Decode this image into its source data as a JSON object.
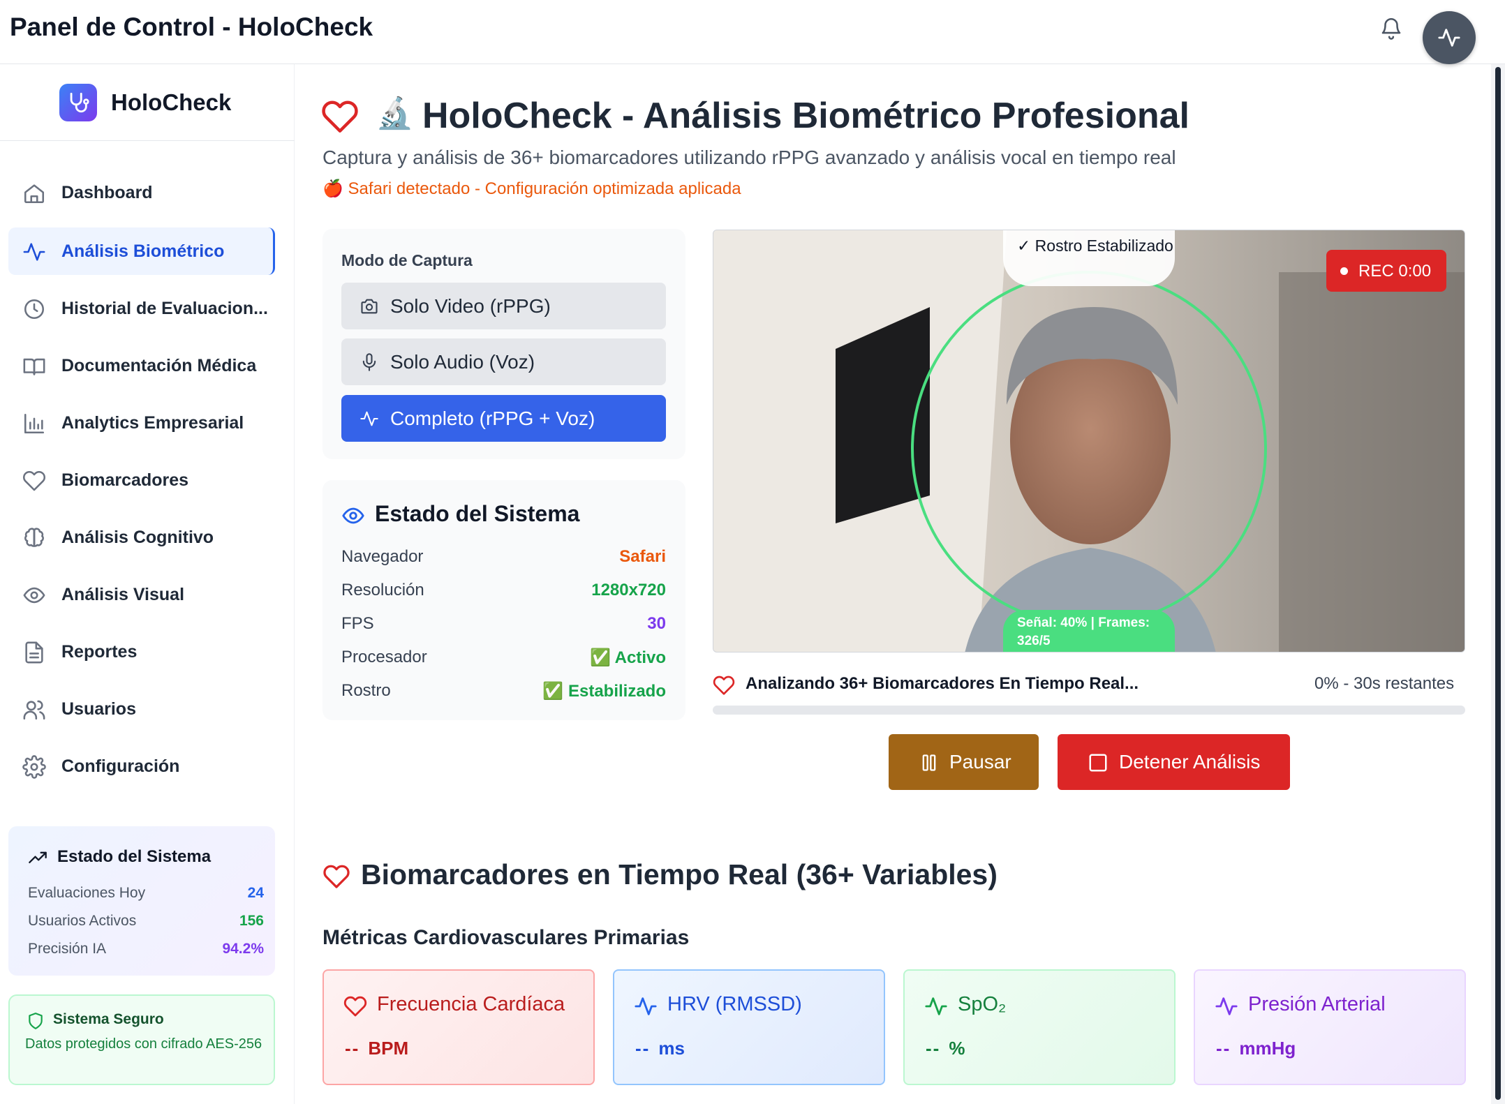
{
  "header": {
    "title": "Panel de Control - HoloCheck",
    "bell_icon": "bell-icon",
    "avatar_icon": "activity-icon"
  },
  "sidebar": {
    "brand": "HoloCheck",
    "items": [
      {
        "label": "Dashboard",
        "icon": "home-icon",
        "active": false
      },
      {
        "label": "Análisis Biométrico",
        "icon": "activity-icon",
        "active": true
      },
      {
        "label": "Historial de Evaluacion...",
        "icon": "clock-icon",
        "active": false
      },
      {
        "label": "Documentación Médica",
        "icon": "book-icon",
        "active": false
      },
      {
        "label": "Analytics Empresarial",
        "icon": "bar-chart-icon",
        "active": false
      },
      {
        "label": "Biomarcadores",
        "icon": "heart-icon",
        "active": false
      },
      {
        "label": "Análisis Cognitivo",
        "icon": "brain-icon",
        "active": false
      },
      {
        "label": "Análisis Visual",
        "icon": "eye-icon",
        "active": false
      },
      {
        "label": "Reportes",
        "icon": "file-icon",
        "active": false
      },
      {
        "label": "Usuarios",
        "icon": "users-icon",
        "active": false
      },
      {
        "label": "Configuración",
        "icon": "gear-icon",
        "active": false
      }
    ],
    "system_status": {
      "title": "Estado del Sistema",
      "rows": [
        {
          "label": "Evaluaciones Hoy",
          "value": "24",
          "color": "#2563eb"
        },
        {
          "label": "Usuarios Activos",
          "value": "156",
          "color": "#16a34a"
        },
        {
          "label": "Precisión IA",
          "value": "94.2%",
          "color": "#7c3aed"
        }
      ]
    },
    "security": {
      "title": "Sistema Seguro",
      "text": "Datos protegidos con cifrado AES-256"
    }
  },
  "main": {
    "title": "HoloCheck - Análisis Biométrico Profesional",
    "title_emoji": "🔬",
    "subtitle": "Captura y análisis de 36+ biomarcadores utilizando rPPG avanzado y análisis vocal en tiempo real",
    "safari_note": "🍎 Safari detectado - Configuración optimizada aplicada",
    "capture": {
      "label": "Modo de Captura",
      "modes": [
        {
          "label": "Solo Video (rPPG)",
          "icon": "camera-icon",
          "selected": false
        },
        {
          "label": "Solo Audio (Voz)",
          "icon": "mic-icon",
          "selected": false
        },
        {
          "label": "Completo (rPPG + Voz)",
          "icon": "activity-icon",
          "selected": true
        }
      ]
    },
    "status": {
      "title": "Estado del Sistema",
      "rows": [
        {
          "label": "Navegador",
          "value": "Safari",
          "color": "#ea580c"
        },
        {
          "label": "Resolución",
          "value": "1280x720",
          "color": "#16a34a"
        },
        {
          "label": "FPS",
          "value": "30",
          "color": "#7c3aed"
        },
        {
          "label": "Procesador",
          "value": "✅ Activo",
          "color": "#16a34a"
        },
        {
          "label": "Rostro",
          "value": "✅ Estabilizado",
          "color": "#16a34a"
        }
      ]
    },
    "video": {
      "face_status": "✓ Rostro Estabilizado",
      "rec": "REC 0:00",
      "signal": "Señal: 40% | Frames: 326/5"
    },
    "progress": {
      "label": "Analizando 36+ Biomarcadores En Tiempo Real...",
      "status": "0% - 30s restantes",
      "value": 0
    },
    "actions": {
      "pause": "Pausar",
      "stop": "Detener Análisis"
    },
    "biomarkers": {
      "title": "Biomarcadores en Tiempo Real (36+ Variables)",
      "subtitle": "Métricas Cardiovasculares Primarias",
      "metrics": [
        {
          "name": "Frecuencia Cardíaca",
          "value": "--",
          "unit": "BPM",
          "icon": "heart-icon"
        },
        {
          "name": "HRV (RMSSD)",
          "value": "--",
          "unit": "ms",
          "icon": "activity-icon"
        },
        {
          "name": "SpO₂",
          "value": "--",
          "unit": "%",
          "icon": "activity-icon"
        },
        {
          "name": "Presión Arterial",
          "value": "--",
          "unit": "mmHg",
          "icon": "activity-icon"
        }
      ]
    }
  }
}
